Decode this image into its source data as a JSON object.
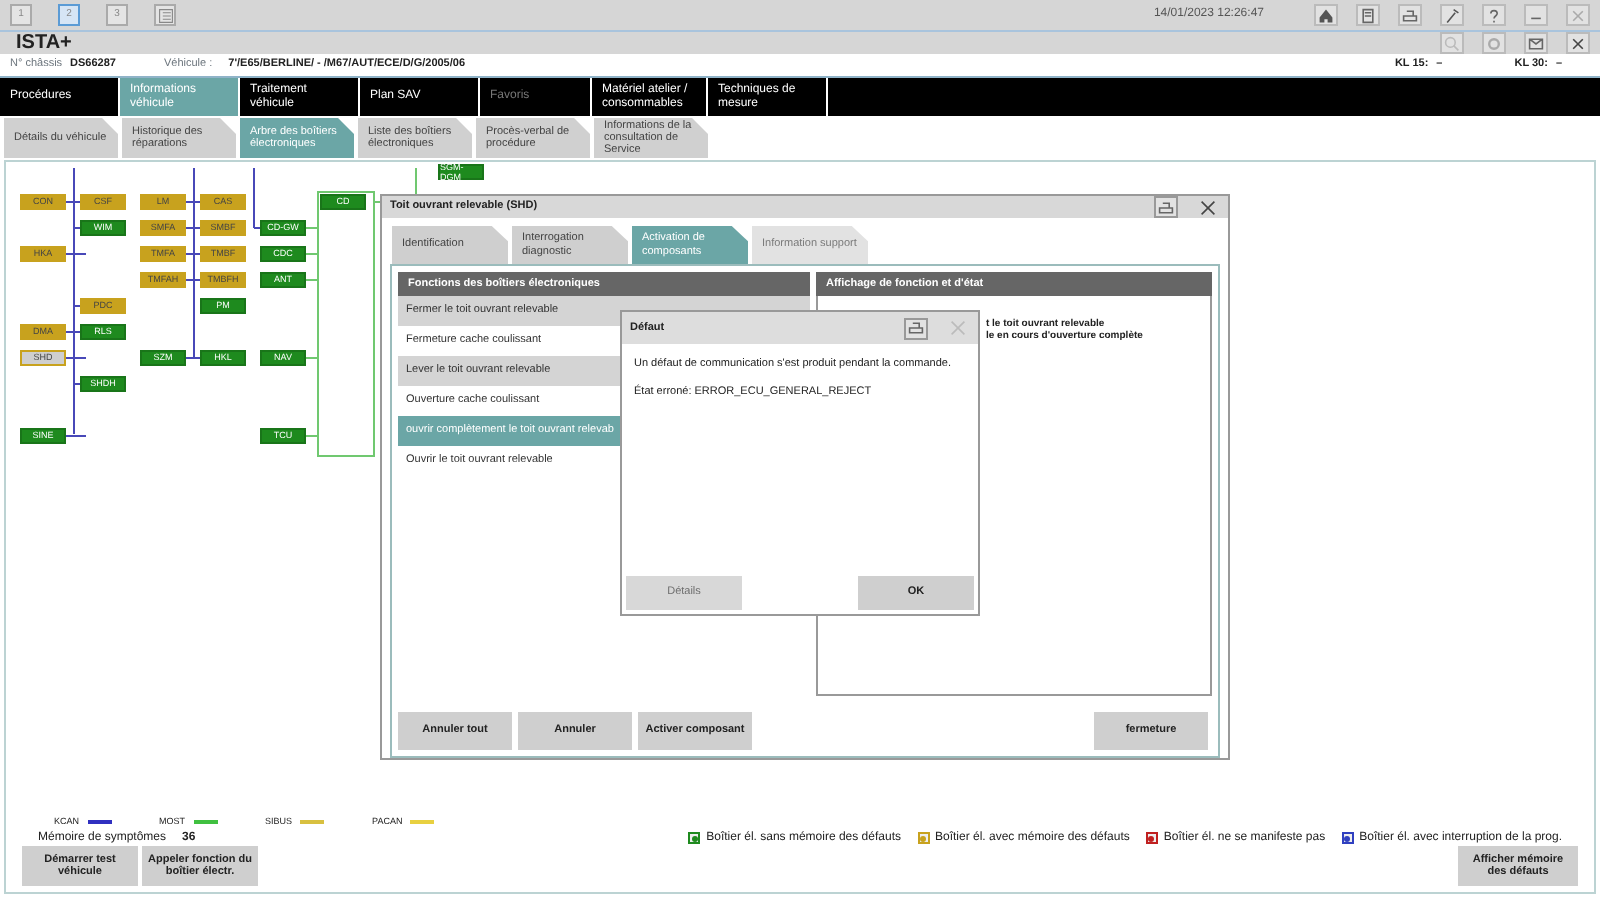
{
  "toolbar": {
    "pages": [
      {
        "label": "1",
        "selected": false
      },
      {
        "label": "2",
        "selected": true
      },
      {
        "label": "3",
        "selected": false
      }
    ],
    "datetime": "14/01/2023 12:26:47"
  },
  "app_title": "ISTA+",
  "vehicle": {
    "chassis_label": "N° châssis",
    "chassis": "DS66287",
    "vehicle_label": "Véhicule :",
    "vehicle": "7'/E65/BERLINE/ - /M67/AUT/ECE/D/G/2005/06",
    "kl15_label": "KL 15:",
    "kl15": "–",
    "kl30_label": "KL 30:",
    "kl30": "–"
  },
  "main_nav": [
    {
      "label": "Procédures",
      "selected": false,
      "disabled": false
    },
    {
      "label": "Informations véhicule",
      "selected": true,
      "disabled": false
    },
    {
      "label": "Traitement véhicule",
      "selected": false,
      "disabled": false
    },
    {
      "label": "Plan SAV",
      "selected": false,
      "disabled": false
    },
    {
      "label": "Favoris",
      "selected": false,
      "disabled": true
    },
    {
      "label": "Matériel atelier / consommables",
      "selected": false,
      "disabled": false
    },
    {
      "label": "Techniques de mesure",
      "selected": false,
      "disabled": false
    }
  ],
  "sub_tabs": [
    {
      "label": "Détails du véhicule",
      "selected": false
    },
    {
      "label": "Historique des réparations",
      "selected": false
    },
    {
      "label": "Arbre des boîtiers électroniques",
      "selected": true
    },
    {
      "label": "Liste des boîtiers électroniques",
      "selected": false
    },
    {
      "label": "Procès-verbal de procédure",
      "selected": false
    },
    {
      "label": "Informations de la consultation de Service",
      "selected": false
    }
  ],
  "diagram": {
    "gateway": {
      "label": "SGM-DGM",
      "color": "#1e8a1e"
    },
    "columns": [
      [
        {
          "label": "CON",
          "color": "#c8a21e"
        },
        {
          "label": "HKA",
          "color": "#c8a21e"
        },
        {
          "label": "DMA",
          "color": "#c8a21e"
        },
        {
          "label": "SHD",
          "color": "#cfcfcf"
        },
        {
          "label": "SINE",
          "color": "#1e8a1e"
        }
      ],
      [
        {
          "label": "CSF",
          "color": "#c8a21e"
        },
        {
          "label": "WIM",
          "color": "#1e8a1e"
        },
        {
          "label": "PDC",
          "color": "#c8a21e"
        },
        {
          "label": "RLS",
          "color": "#1e8a1e"
        },
        {
          "label": "SHDH",
          "color": "#1e8a1e"
        }
      ],
      [
        {
          "label": "LM",
          "color": "#c8a21e"
        },
        {
          "label": "SMFA",
          "color": "#c8a21e"
        },
        {
          "label": "TMFA",
          "color": "#c8a21e"
        },
        {
          "label": "TMFAH",
          "color": "#c8a21e"
        },
        {
          "label": "SZM",
          "color": "#1e8a1e"
        }
      ],
      [
        {
          "label": "CAS",
          "color": "#c8a21e"
        },
        {
          "label": "SMBF",
          "color": "#c8a21e"
        },
        {
          "label": "TMBF",
          "color": "#c8a21e"
        },
        {
          "label": "TMBFH",
          "color": "#c8a21e"
        },
        {
          "label": "PM",
          "color": "#1e8a1e"
        },
        {
          "label": "HKL",
          "color": "#1e8a1e"
        }
      ],
      [
        {
          "label": "CD-GW",
          "color": "#1e8a1e"
        },
        {
          "label": "CDC",
          "color": "#1e8a1e"
        },
        {
          "label": "ANT",
          "color": "#1e8a1e"
        },
        {
          "label": "NAV",
          "color": "#1e8a1e"
        },
        {
          "label": "TCU",
          "color": "#1e8a1e"
        }
      ],
      [
        {
          "label": "CD",
          "color": "#1e8a1e"
        }
      ]
    ]
  },
  "ecu_window": {
    "title": "Toit ouvrant relevable (SHD)",
    "tabs": [
      {
        "label": "Identification",
        "selected": false,
        "disabled": false
      },
      {
        "label": "Interrogation diagnostic",
        "selected": false,
        "disabled": false
      },
      {
        "label": "Activation de composants",
        "selected": true,
        "disabled": false
      },
      {
        "label": "Information support",
        "selected": false,
        "disabled": true
      }
    ],
    "functions_header": "Fonctions des boîtiers électroniques",
    "functions": [
      {
        "label": "Fermer le toit ouvrant relevable",
        "selected": false
      },
      {
        "label": "Fermeture cache coulissant",
        "selected": false
      },
      {
        "label": "Lever le toit ouvrant relevable",
        "selected": false
      },
      {
        "label": "Ouverture cache coulissant",
        "selected": false
      },
      {
        "label": "ouvrir complètement le toit ouvrant relevab",
        "selected": true
      },
      {
        "label": "Ouvrir le toit ouvrant relevable",
        "selected": false
      }
    ],
    "status_header": "Affichage de fonction et d'état",
    "status_lines": [
      "t le toit ouvrant relevable",
      "le en cours d'ouverture complète"
    ],
    "buttons": [
      "Annuler tout",
      "Annuler",
      "Activer composant"
    ],
    "close_button": "fermeture"
  },
  "error_dialog": {
    "title": "Défaut",
    "message": "Un défaut de communication s'est produit pendant la commande.",
    "state": "État erroné: ERROR_ECU_GENERAL_REJECT",
    "buttons": [
      {
        "label": "Détails",
        "disabled": true
      },
      {
        "label": "OK",
        "disabled": false
      }
    ]
  },
  "bus_legend": [
    {
      "label": "KCAN",
      "color": "#3030c0"
    },
    {
      "label": "MOST",
      "color": "#40c040"
    },
    {
      "label": "SIBUS",
      "color": "#d8c040"
    },
    {
      "label": "PACAN",
      "color": "#e8d040"
    }
  ],
  "symptoms": {
    "label": "Mémoire de symptômes",
    "value": "36"
  },
  "ecu_legend": [
    {
      "label": "Boîtier él. sans mémoire des défauts",
      "color": "#1e8a1e"
    },
    {
      "label": "Boîtier él. avec mémoire des défauts",
      "color": "#c8a21e"
    },
    {
      "label": "Boîtier él. ne se manifeste pas",
      "color": "#c02020"
    },
    {
      "label": "Boîtier él. avec interruption de la prog.",
      "color": "#3040c0"
    }
  ],
  "bottom_buttons": [
    "Démarrer test véhicule",
    "Appeler fonction du boîtier électr."
  ],
  "right_button": "Afficher mémoire des défauts"
}
